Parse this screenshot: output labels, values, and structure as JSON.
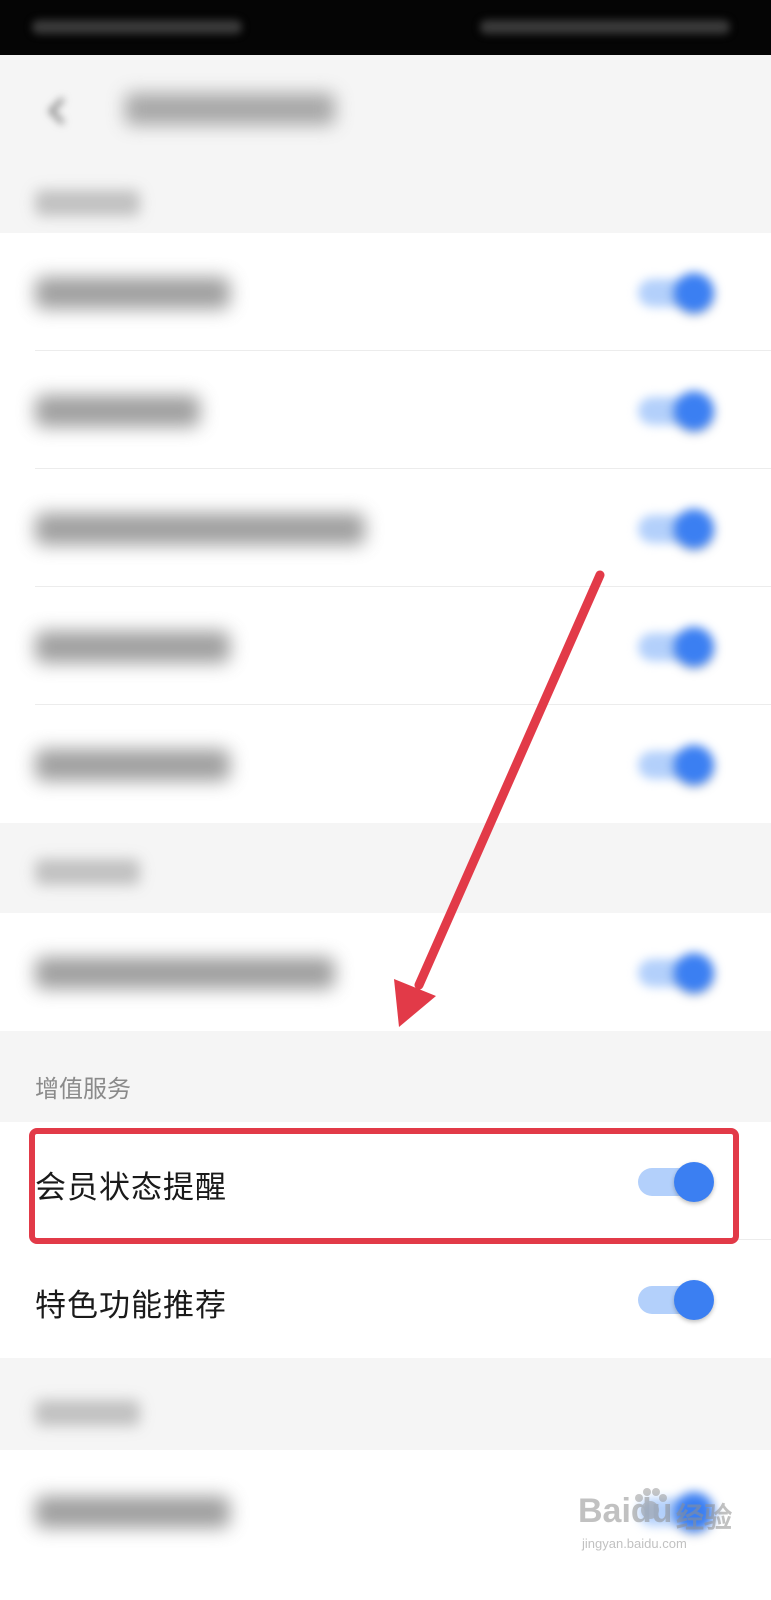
{
  "colors": {
    "accent": "#3b7ff2",
    "annotation": "#e23a48",
    "section_bg": "#f5f5f5"
  },
  "icons": {
    "back": "chevron-left-icon",
    "toggle": "toggle-switch-icon"
  },
  "blurred_rows": [
    {
      "enabled": true
    },
    {
      "enabled": true
    },
    {
      "enabled": true
    },
    {
      "enabled": true
    },
    {
      "enabled": true
    },
    {
      "enabled": true
    }
  ],
  "value_added": {
    "title": "增值服务",
    "items": [
      {
        "label": "会员状态提醒",
        "enabled": true,
        "highlighted": true
      },
      {
        "label": "特色功能推荐",
        "enabled": true,
        "highlighted": false
      }
    ]
  },
  "last_row": {
    "enabled": true
  },
  "watermark": {
    "brand": "Baidu",
    "sub": "经验",
    "url": "jingyan.baidu.com"
  }
}
